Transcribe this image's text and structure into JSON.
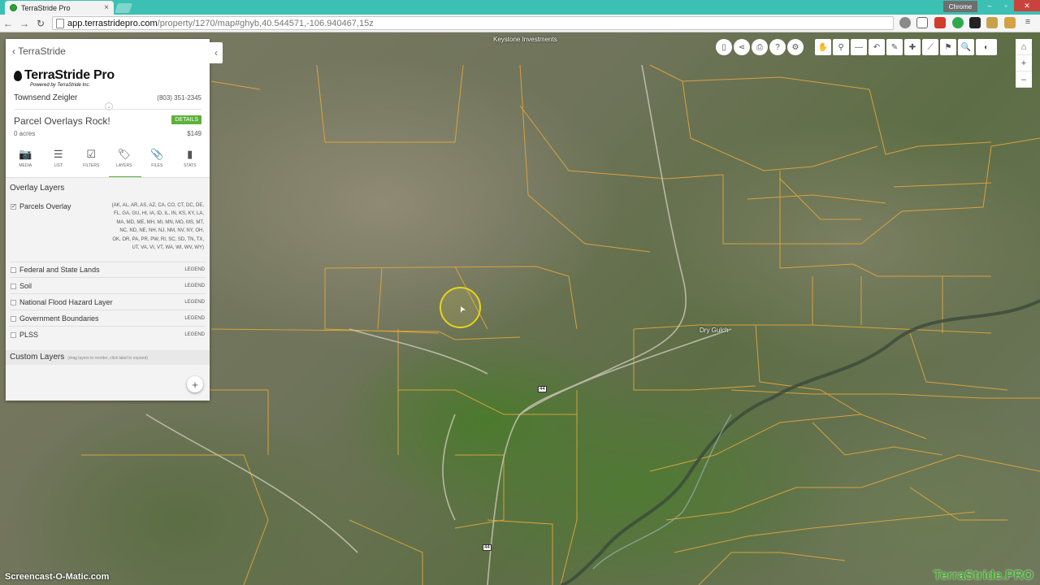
{
  "browser": {
    "tab_title": "TerraStride Pro",
    "tab_close": "×",
    "chrome_label": "Chrome",
    "url_host": "app.terrastridepro.com",
    "url_path": "/property/1270/map#ghyb,40.544571,-106.940467,15z",
    "back": "←",
    "forward": "→",
    "reload": "↻"
  },
  "panel": {
    "back_label": "TerraStride",
    "brand": "TerraStride Pro",
    "powered_by": "Powered by  TerraStride Inc.",
    "user_name": "Townsend Zeigler",
    "phone": "(803) 351-2345",
    "property_title": "Parcel Overlays Rock!",
    "details_label": "DETAILS",
    "acres": "0 acres",
    "price": "$149",
    "tools": [
      {
        "label": "MEDIA",
        "icon": "camera-icon",
        "glyph": "📷"
      },
      {
        "label": "LIST",
        "icon": "list-icon",
        "glyph": "☰"
      },
      {
        "label": "FILTERS",
        "icon": "checkbox-icon",
        "glyph": "☑"
      },
      {
        "label": "LAYERS",
        "icon": "tags-icon",
        "glyph": "🏷"
      },
      {
        "label": "FILES",
        "icon": "paperclip-icon",
        "glyph": "📎"
      },
      {
        "label": "STATS",
        "icon": "bar-chart-icon",
        "glyph": "▮"
      }
    ],
    "active_tool": "LAYERS",
    "overlay_header": "Overlay Layers",
    "parcels_label": "Parcels Overlay",
    "parcels_checked": true,
    "parcels_states": "(AK, AL, AR, AS, AZ, CA, CO, CT, DC, DE, FL, GA, GU, HI, IA, ID, IL, IN, KS, KY, LA, MA, MD, ME, MH, MI, MN, MO, MS, MT, NC, ND, NE, NH, NJ, NM, NV, NY, OH, OK, OR, PA, PR, PW, RI, SC, SD, TN, TX, UT, VA, VI, VT, WA, WI, WV, WY)",
    "layers": [
      {
        "label": "Federal and State Lands",
        "legend": "LEGEND"
      },
      {
        "label": "Soil",
        "legend": "LEGEND"
      },
      {
        "label": "National Flood Hazard Layer",
        "legend": "LEGEND"
      },
      {
        "label": "Government Boundaries",
        "legend": "LEGEND"
      },
      {
        "label": "PLSS",
        "legend": "LEGEND"
      }
    ],
    "custom_header": "Custom Layers",
    "custom_hint": "(drag layers to reorder, click label to expand)",
    "add_label": "+",
    "collapse_label": "‹"
  },
  "map": {
    "label_keystone": "Keystone Investments",
    "label_gulch": "Dry Gulch",
    "route_a": "44",
    "route_b": "44"
  },
  "toolbar1": [
    "▯",
    "⋖",
    "⎙",
    "?",
    "⚙"
  ],
  "toolbar2": [
    "✋",
    "⚲",
    "—",
    "↶",
    "✎",
    "✚",
    "⟋",
    "⚑",
    "🔍",
    "◐"
  ],
  "zoom": [
    "⌂",
    "+",
    "–"
  ],
  "watermarks": {
    "left": "Screencast-O-Matic.com",
    "right": "TerraStride.PRO"
  },
  "colors": {
    "accent": "#5cb13a",
    "parcel_line": "#e3a73c",
    "tabbar": "#3cc0b4"
  }
}
